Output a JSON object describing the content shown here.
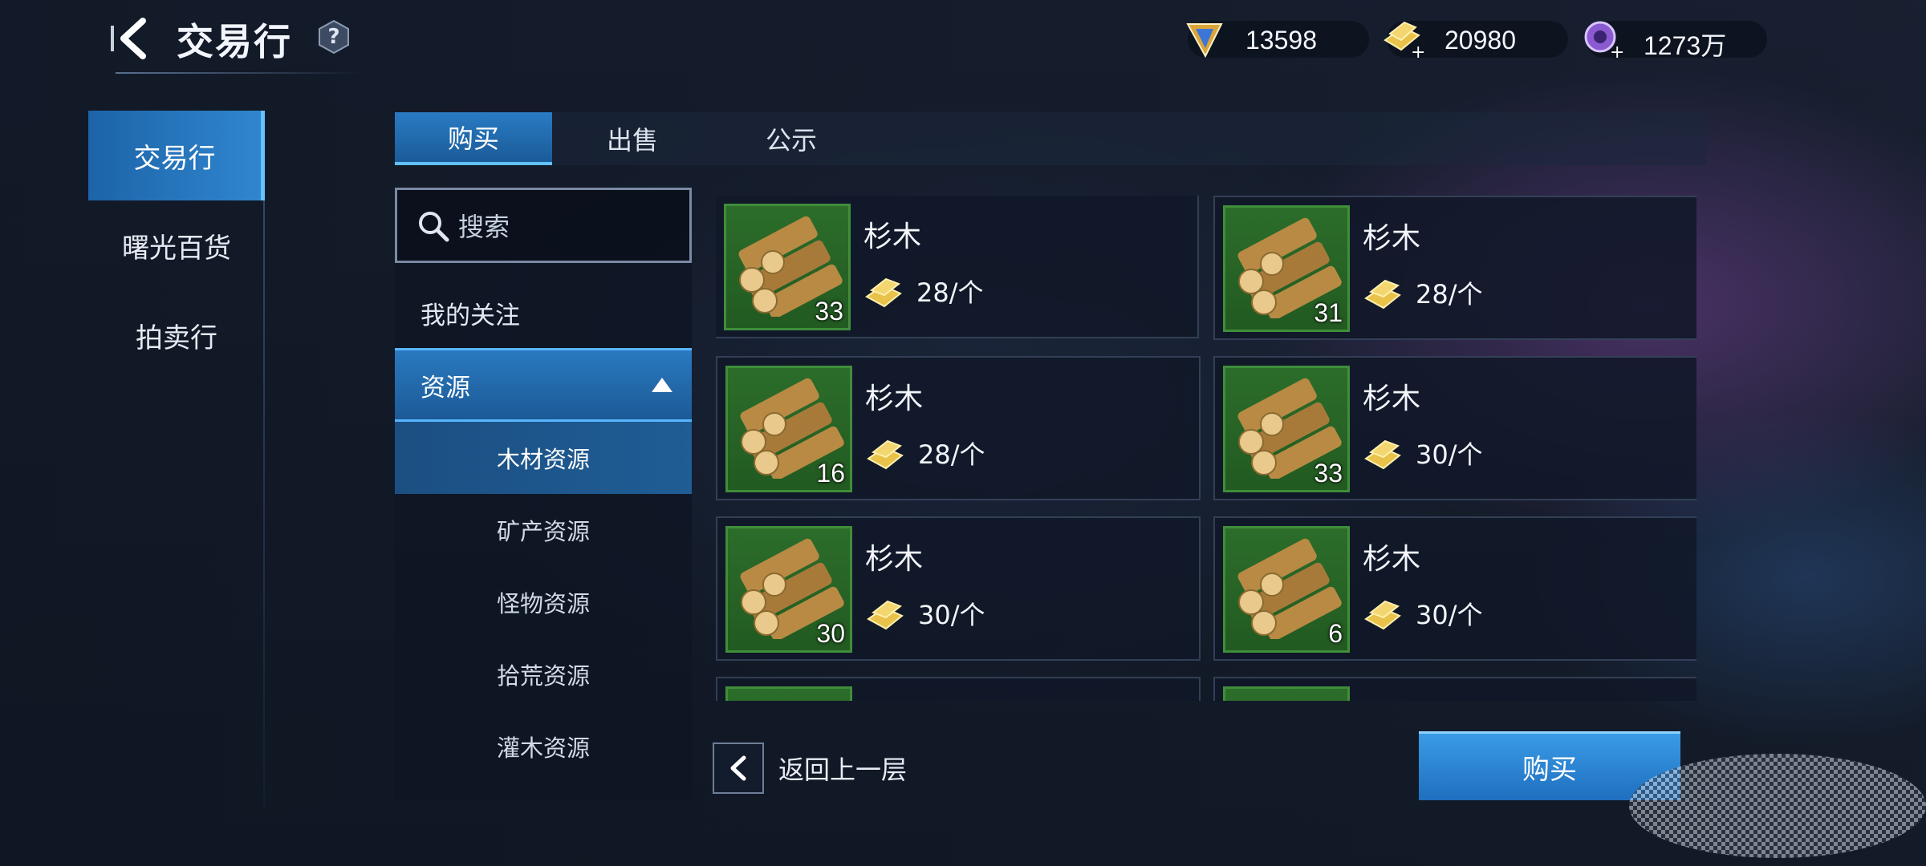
{
  "header": {
    "title": "交易行",
    "help_label": "?"
  },
  "currencies": [
    {
      "icon": "blue-gem-icon",
      "value": "13598"
    },
    {
      "icon": "gold-plus-icon",
      "value": "20980"
    },
    {
      "icon": "purple-coin-plus-icon",
      "value": "1273万"
    }
  ],
  "side_nav": {
    "items": [
      {
        "label": "交易行",
        "active": true
      },
      {
        "label": "曙光百货",
        "active": false
      },
      {
        "label": "拍卖行",
        "active": false
      }
    ]
  },
  "tabs": [
    {
      "label": "购买",
      "active": true
    },
    {
      "label": "出售",
      "active": false
    },
    {
      "label": "公示",
      "active": false
    }
  ],
  "category": {
    "search_placeholder": "搜索",
    "follow_label": "我的关注",
    "group_label": "资源",
    "subcategories": [
      {
        "label": "木材资源",
        "active": true
      },
      {
        "label": "矿产资源",
        "active": false
      },
      {
        "label": "怪物资源",
        "active": false
      },
      {
        "label": "拾荒资源",
        "active": false
      },
      {
        "label": "灌木资源",
        "active": false
      }
    ]
  },
  "items": [
    {
      "name": "杉木",
      "qty": "33",
      "price": "28/个",
      "selected": true
    },
    {
      "name": "杉木",
      "qty": "31",
      "price": "28/个",
      "selected": false
    },
    {
      "name": "杉木",
      "qty": "16",
      "price": "28/个",
      "selected": false
    },
    {
      "name": "杉木",
      "qty": "33",
      "price": "30/个",
      "selected": false
    },
    {
      "name": "杉木",
      "qty": "30",
      "price": "30/个",
      "selected": false
    },
    {
      "name": "杉木",
      "qty": "6",
      "price": "30/个",
      "selected": false
    }
  ],
  "footer": {
    "return_label": "返回上一层",
    "buy_label": "购买"
  },
  "colors": {
    "accent": "#2f86cf",
    "highlight": "#3aa6ff",
    "item_bg_green": "#2c6d2a"
  }
}
